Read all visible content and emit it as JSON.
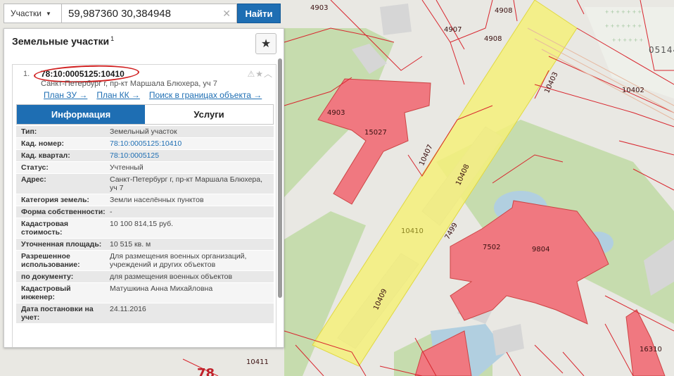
{
  "search": {
    "type_label": "Участки",
    "query": "59,987360 30,384948",
    "submit_label": "Найти"
  },
  "panel": {
    "title": "Земельные участки",
    "count": "1"
  },
  "result": {
    "index": "1.",
    "cadastral_number": "78:10:0005125:10410",
    "address": "Санкт-Петербург г, пр-кт Маршала Блюхера, уч 7",
    "links": [
      "План ЗУ →",
      "План КК →",
      "Поиск в границах объекта →"
    ],
    "tabs": [
      "Информация",
      "Услуги"
    ],
    "active_tab": "Информация",
    "info": [
      {
        "key": "Тип:",
        "value": "Земельный участок"
      },
      {
        "key": "Кад. номер:",
        "value": "78:10:0005125:10410"
      },
      {
        "key": "Кад. квартал:",
        "value": "78:10:0005125"
      },
      {
        "key": "Статус:",
        "value": "Учтенный"
      },
      {
        "key": "Адрес:",
        "value": "Санкт-Петербург г, пр-кт Маршала Блюхера, уч 7"
      },
      {
        "key": "Категория земель:",
        "value": "Земли населённых пунктов"
      },
      {
        "key": "Форма собственности:",
        "value": "-"
      },
      {
        "key": "Кадастровая стоимость:",
        "value": "10 100 814,15 руб."
      },
      {
        "key": "Уточненная площадь:",
        "value": "10 515 кв. м"
      },
      {
        "key": "Разрешенное использование:",
        "value": "Для размещения военных организаций, учреждений и других объектов"
      },
      {
        "key": "по документу:",
        "value": "для размещения военных объектов"
      },
      {
        "key": "Кадастровый инженер:",
        "value": "Матушкина Анна Михайловна"
      },
      {
        "key": "Дата постановки на учет:",
        "value": "24.11.2016"
      }
    ]
  },
  "map_labels": [
    "4903",
    "4908",
    "4907",
    "4908",
    "05144",
    "10403",
    "10402",
    "4903",
    "15027",
    "10407",
    "10408",
    "10410",
    "7499",
    "7502",
    "9804",
    "10409",
    "10411",
    "16310",
    "78"
  ],
  "colors": {
    "accent": "#1e6eb3",
    "parcel_red": "#f07880",
    "highlight_yellow": "#f5f07a",
    "green_area": "#c6dcae",
    "building_grey": "#d6d6d6",
    "water": "#b1cfe0"
  }
}
